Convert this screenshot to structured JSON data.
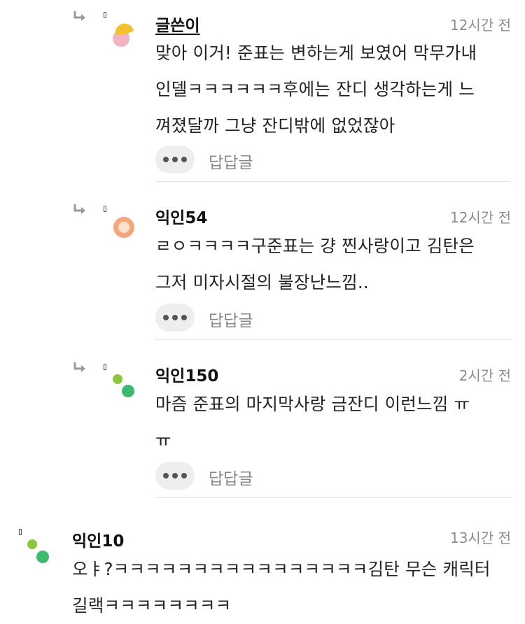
{
  "comments": [
    {
      "nickname": "글쓴이",
      "is_author": true,
      "time": "12시간 전",
      "lines": [
        "맞아 이거! 준표는 변하는게 보였어 막무가내",
        "인델ㅋㅋㅋㅋㅋㅋ후에는 잔디 생각하는게 느",
        "껴졌달까 그냥 잔디밖에 없었잖아"
      ],
      "reply_label": "답답글"
    },
    {
      "nickname": "익인54",
      "is_author": false,
      "time": "12시간 전",
      "lines": [
        "ㄹㅇㅋㅋㅋㅋ구준표는 걍 찐사랑이고 김탄은",
        "그저 미자시절의 불장난느낌.."
      ],
      "reply_label": "답답글"
    },
    {
      "nickname": "익인150",
      "is_author": false,
      "time": "2시간 전",
      "lines": [
        "마즘 준표의 마지막사랑 금잔디 이런느낌 ㅠ",
        "ㅠ"
      ],
      "reply_label": "답답글"
    },
    {
      "nickname": "익인10",
      "is_author": false,
      "time": "13시간 전",
      "lines": [
        "오ㅑ?ㅋㅋㅋㅋㅋㅋㅋㅋㅋㅋㅋㅋㅋㅋㅋㅋ김탄 무슨 캐릭터",
        "길랙ㅋㅋㅋㅋㅋㅋㅋㅋ"
      ]
    }
  ],
  "icons": {
    "reply_arrow": "reply-arrow-icon",
    "more": "more-options-icon"
  },
  "colors": {
    "avatar_author_yellow": "#f2c12e",
    "avatar_author_pink": "#f3b3c2",
    "avatar_orange": "#f4a77a",
    "avatar_green_light": "#8cc63f",
    "avatar_green_dark": "#3dba6f",
    "time_gray": "#8c8c8c",
    "reply_gray": "#888888",
    "button_bg": "#eeeeee"
  }
}
